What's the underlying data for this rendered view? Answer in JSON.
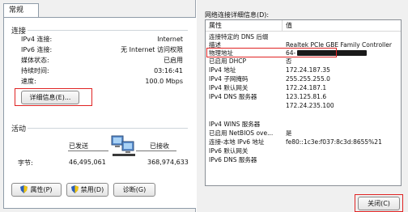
{
  "left": {
    "tab_label": "常规",
    "connection_group": "连接",
    "rows": [
      {
        "label": "IPv4 连接:",
        "value": "Internet"
      },
      {
        "label": "IPv6 连接:",
        "value": "无 Internet 访问权限"
      },
      {
        "label": "媒体状态:",
        "value": "已启用"
      },
      {
        "label": "持续时间:",
        "value": "03:16:41"
      },
      {
        "label": "速度:",
        "value": "100.0 Mbps"
      }
    ],
    "details_button": "详细信息(E)...",
    "activity_group": "活动",
    "sent_label": "已发送",
    "received_label": "已接收",
    "bytes_label": "字节:",
    "bytes_sent": "46,495,061",
    "bytes_received": "368,974,633",
    "properties_button": "属性(P)",
    "disable_button": "禁用(D)",
    "diagnose_button": "诊断(G)"
  },
  "right": {
    "title": "网络连接详细信息(D):",
    "col_property": "属性",
    "col_value": "值",
    "rows": [
      {
        "prop": "连接特定的 DNS 后缀",
        "value": ""
      },
      {
        "prop": "描述",
        "value": "Realtek PCIe GBE Family Controller"
      },
      {
        "prop": "物理地址",
        "value": "64-"
      },
      {
        "prop": "已启用 DHCP",
        "value": "否"
      },
      {
        "prop": "IPv4 地址",
        "value": "172.24.187.35"
      },
      {
        "prop": "IPv4 子网掩码",
        "value": "255.255.255.0"
      },
      {
        "prop": "IPv4 默认网关",
        "value": "172.24.187.1"
      },
      {
        "prop": "IPv4 DNS 服务器",
        "value": "123.125.81.6"
      },
      {
        "prop": "",
        "value": "172.24.235.100"
      },
      {
        "prop": "IPv4 WINS 服务器",
        "value": ""
      },
      {
        "prop": "已启用 NetBIOS ove...",
        "value": "是"
      },
      {
        "prop": "连接-本地 IPv6 地址",
        "value": "fe80::1c3e:f037:8c3d:8655%21"
      },
      {
        "prop": "IPv6 默认网关",
        "value": ""
      },
      {
        "prop": "IPv6 DNS 服务器",
        "value": ""
      }
    ],
    "close_button": "关闭(C)"
  },
  "colors": {
    "highlight": "#e02424",
    "shield_blue": "#2b5fb8",
    "shield_yellow": "#f1c40f"
  }
}
